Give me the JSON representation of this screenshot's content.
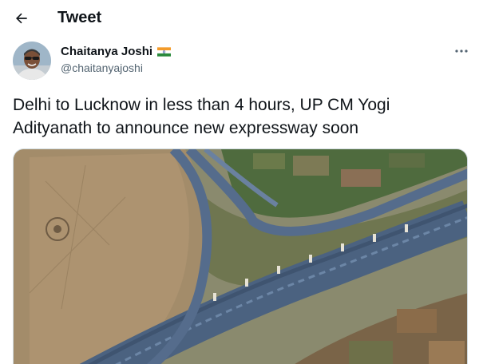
{
  "header": {
    "back_icon": "arrow-left-icon",
    "title": "Tweet"
  },
  "tweet": {
    "author_name": "Chaitanya Joshi",
    "author_flag": "india-flag-icon",
    "author_handle": "@chaitanyajoshi",
    "text": "Delhi to Lucknow in less than 4 hours, UP CM Yogi Adityanath to announce new expressway soon",
    "more_icon": "more-horizontal-icon",
    "media_description_icon": "expressway-photo"
  },
  "colors": {
    "text_primary": "#0f1419",
    "text_secondary": "#536471",
    "border": "#cfd9de"
  }
}
